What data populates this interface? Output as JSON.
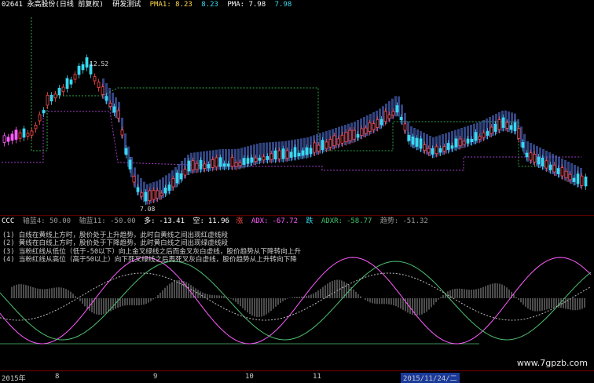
{
  "header": {
    "code_name": "02641 永高股份(日线 前复权)",
    "indicator_name": "研发测试",
    "pma1_label": "PMA1: 8.23",
    "pma1_value": "8.23",
    "pma_label": "PMA: 7.98",
    "pma_value": "7.98"
  },
  "main_chart": {
    "high_label": "12.52",
    "low_label": "7.08"
  },
  "indicator": {
    "name": "CCC",
    "p1": "轴蓝4: 50.00",
    "p2": "轴蓝11: -50.00",
    "long_label": "多:",
    "long_value": "-13.41",
    "short_label": "空:",
    "short_value": "11.96",
    "rise_tag": "涨",
    "fall_tag": "跌",
    "adx_label": "ADX:",
    "adx_value": "-67.72",
    "adxr_label": "ADXR:",
    "adxr_value": "-58.77",
    "trend_label": "趋势:",
    "trend_value": "-51.32"
  },
  "legend_lines": [
    "(1) 白线在黄线上方时，股价处于上升趋势，此时白黄线之间出现红虚线段",
    "(2) 黄线在白线上方时，股价处于下降趋势，此时黄白线之间出现绿虚线段",
    "(3) 当粉红线从低位（低于-50以下）向上金叉绿线之后而金叉灰白虚线，股价趋势从下降转向上升",
    "(4) 当粉红线从高位（高于50以上）向下死叉绿线之后再死叉灰白虚线，股价趋势从上升转向下降"
  ],
  "time_axis": {
    "labels": [
      "2015年",
      "8",
      "9",
      "10",
      "11"
    ],
    "cursor_date": "2015/11/24/二"
  },
  "watermark": "www.7gpzb.com",
  "colors": {
    "up": "#ff4a4a",
    "down": "#38d8f0",
    "band": "#5a7ae8",
    "pma_green": "#2fa84a",
    "pma_purple": "#a040c8",
    "magenta": "#ff5cff",
    "ind_green": "#4ec070"
  }
}
